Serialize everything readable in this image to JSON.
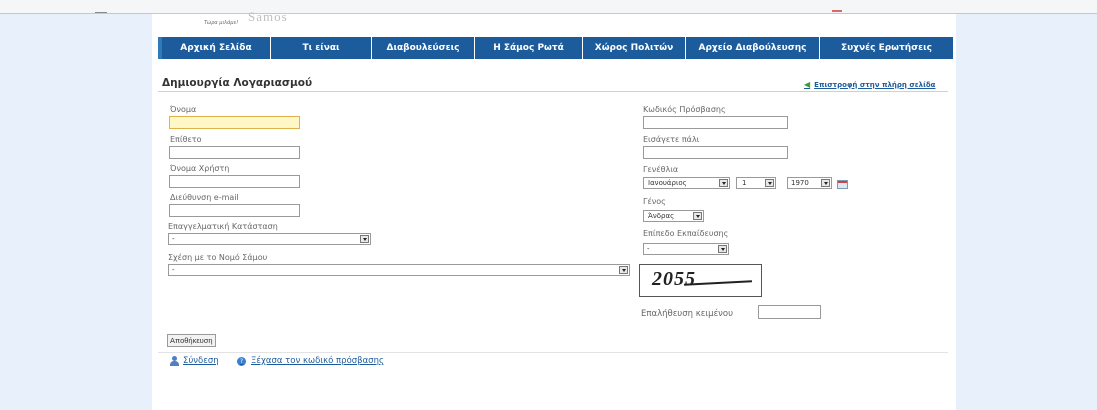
{
  "header": {
    "logo_text": "Samos",
    "tagline": "Τώρα μιλάμε!"
  },
  "nav": {
    "items": [
      {
        "label": "Αρχική Σελίδα"
      },
      {
        "label": "Τι είναι"
      },
      {
        "label": "Διαβουλεύσεις"
      },
      {
        "label": "Η Σάμος Ρωτά"
      },
      {
        "label": "Χώρος Πολιτών"
      },
      {
        "label": "Αρχείο Διαβούλευσης"
      },
      {
        "label": "Συχνές Ερωτήσεις"
      }
    ]
  },
  "page": {
    "title": "Δημιουργία Λογαριασμού",
    "back_link": "Επιστροφή στην πλήρη σελίδα"
  },
  "form": {
    "first_name": {
      "label": "Όνομα",
      "value": ""
    },
    "last_name": {
      "label": "Επίθετο",
      "value": ""
    },
    "username": {
      "label": "Όνομα Χρήστη",
      "value": ""
    },
    "email": {
      "label": "Διεύθυνση e-mail",
      "value": ""
    },
    "occupation": {
      "label": "Επαγγελματική Κατάσταση",
      "value": "-"
    },
    "relation": {
      "label": "Σχέση με το Νομό Σάμου",
      "value": "-"
    },
    "password": {
      "label": "Κωδικός Πρόσβασης",
      "value": ""
    },
    "password_confirm": {
      "label": "Εισάγετε πάλι",
      "value": ""
    },
    "birthdate": {
      "label": "Γενέθλια",
      "month": "Ιανουάριος",
      "day": "1",
      "year": "1970"
    },
    "gender": {
      "label": "Γένος",
      "value": "Άνδρας"
    },
    "education": {
      "label": "Επίπεδο Εκπαίδευσης",
      "value": "-"
    },
    "captcha": {
      "text": "2055",
      "label": "Επαλήθευση κειμένου",
      "value": ""
    },
    "save_label": "Αποθήκευση"
  },
  "footer_links": {
    "login": "Σύνδεση",
    "forgot": "Ξέχασα τον κωδικό πρόσβασης"
  }
}
